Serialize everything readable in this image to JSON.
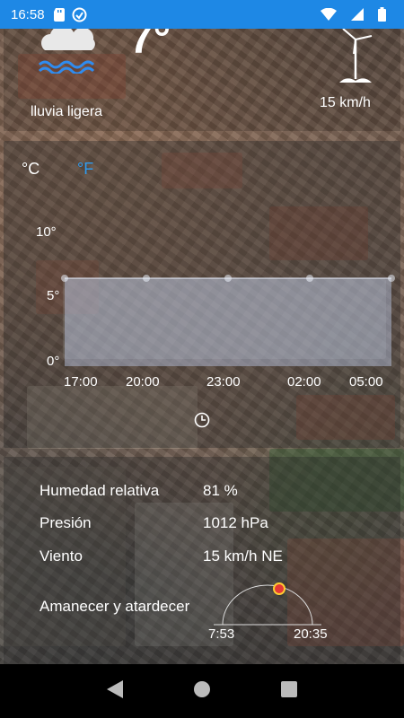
{
  "status_bar": {
    "time": "16:58"
  },
  "current": {
    "temperature": "7°",
    "condition": "lluvia ligera",
    "wind_speed": "15 km/h",
    "condition_icon": "cloud-rain-icon",
    "wind_icon": "wind-turbine-icon"
  },
  "chart": {
    "unit_c": "°C",
    "unit_f": "°F",
    "y_ticks": [
      "10°",
      "5°",
      "0°"
    ],
    "x_ticks": [
      "17:00",
      "20:00",
      "23:00",
      "02:00",
      "05:00"
    ]
  },
  "chart_data": {
    "type": "area",
    "x": [
      "17:00",
      "20:00",
      "23:00",
      "02:00",
      "05:00"
    ],
    "series": [
      {
        "values": [
          7,
          7,
          7,
          7,
          7
        ]
      }
    ],
    "ylim": [
      0,
      12
    ],
    "y_ticks": [
      0,
      5,
      10
    ]
  },
  "details": {
    "humidity_label": "Humedad relativa",
    "humidity_value": "81 %",
    "pressure_label": "Presión",
    "pressure_value": "1012 hPa",
    "wind_label": "Viento",
    "wind_value": "15 km/h NE",
    "sun_label": "Amanecer y atardecer",
    "sunrise": "7:53",
    "sunset": "20:35"
  },
  "colors": {
    "status_bar": "#1e88e5",
    "fahrenheit": "#2f9cf0",
    "sun": "#e53935"
  }
}
